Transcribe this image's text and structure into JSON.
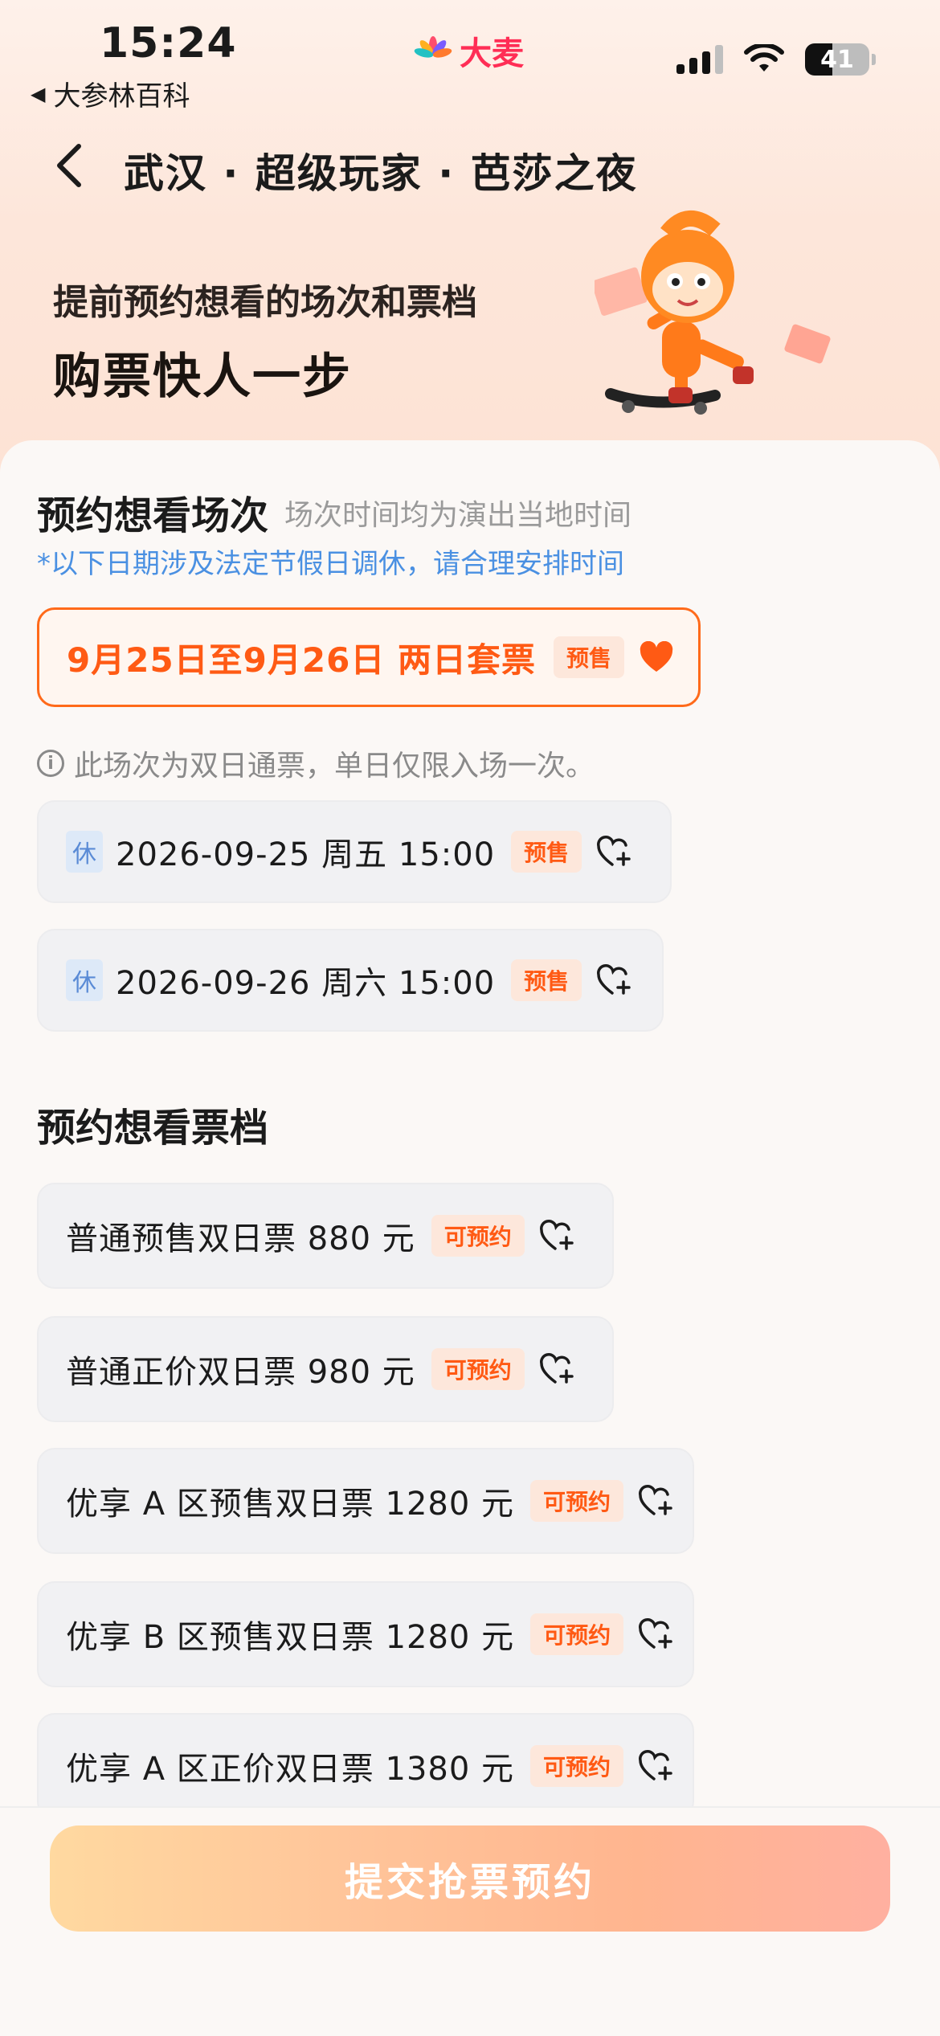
{
  "status_bar": {
    "time": "15:24",
    "back_app": "大参林百科",
    "brand": "大麦",
    "battery": "41"
  },
  "nav": {
    "title": "武汉 · 超级玩家 · 芭莎之夜"
  },
  "promo": {
    "line1": "提前预约想看的场次和票档",
    "line2": "购票快人一步"
  },
  "session_section": {
    "title": "预约想看场次",
    "subtitle": "场次时间均为演出当地时间",
    "holiday_note": "*以下日期涉及法定节假日调休，请合理安排时间",
    "package": {
      "label": "9月25日至9月26日 两日套票",
      "badge": "预售"
    },
    "info_note": "此场次为双日通票，单日仅限入场一次。",
    "sessions": [
      {
        "tag": "休",
        "label": "2026-09-25  周五 15:00",
        "badge": "预售"
      },
      {
        "tag": "休",
        "label": "2026-09-26 周六 15:00",
        "badge": "预售"
      }
    ]
  },
  "ticket_section": {
    "title": "预约想看票档",
    "tickets": [
      {
        "label": "普通预售双日票 880 元",
        "badge": "可预约"
      },
      {
        "label": "普通正价双日票 980 元",
        "badge": "可预约"
      },
      {
        "label": "优享 A 区预售双日票 1280 元",
        "badge": "可预约"
      },
      {
        "label": "优享 B 区预售双日票 1280 元",
        "badge": "可预约"
      },
      {
        "label": "优享 A 区正价双日票 1380 元",
        "badge": "可预约"
      }
    ]
  },
  "submit": {
    "label": "提交抢票预约"
  },
  "colors": {
    "accent": "#ff5a14",
    "holiday_blue": "#4a90e2",
    "brand": "#ff2d55"
  }
}
